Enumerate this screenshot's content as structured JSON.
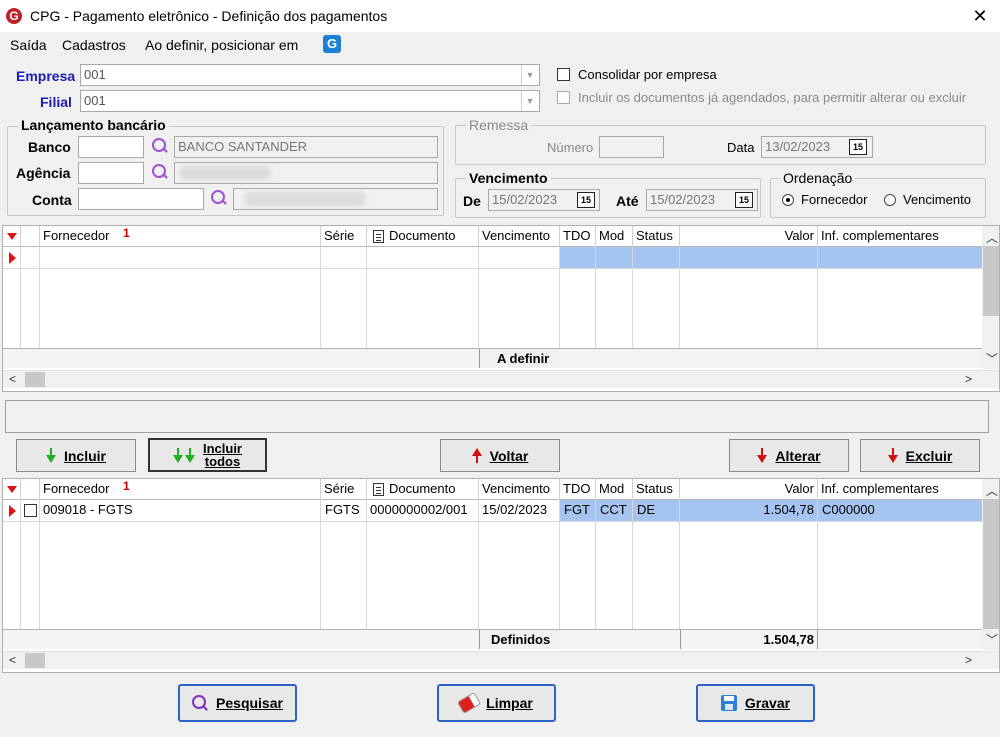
{
  "window": {
    "title": "CPG - Pagamento eletrônico - Definição dos pagamentos",
    "logo_letter": "G"
  },
  "menu": {
    "items": [
      "Saída",
      "Cadastros",
      "Ao definir, posicionar em"
    ],
    "g_icon": "G"
  },
  "filters": {
    "empresa_label": "Empresa",
    "empresa_value": "001",
    "filial_label": "Filial",
    "filial_value": "001",
    "consolidar_label": "Consolidar por empresa",
    "incluir_agendados_label": "Incluir os documentos já agendados, para permitir alterar ou excluir"
  },
  "lancamento": {
    "title": "Lançamento bancário",
    "banco_label": "Banco",
    "banco_name": "BANCO SANTANDER",
    "agencia_label": "Agência",
    "conta_label": "Conta"
  },
  "remessa": {
    "title": "Remessa",
    "numero_label": "Número",
    "data_label": "Data",
    "data_value": "13/02/2023",
    "cal_icon": "15"
  },
  "vencimento": {
    "title": "Vencimento",
    "de_label": "De",
    "de_value": "15/02/2023",
    "ate_label": "Até",
    "ate_value": "15/02/2023",
    "cal_icon": "15"
  },
  "ordenacao": {
    "title": "Ordenação",
    "options": [
      "Fornecedor",
      "Vencimento"
    ],
    "selected": "Fornecedor"
  },
  "grid_columns": {
    "fornecedor": "Fornecedor",
    "sort_indicator": "1",
    "serie": "Série",
    "documento": "Documento",
    "vencimento": "Vencimento",
    "tdo": "TDO",
    "mod": "Mod",
    "status": "Status",
    "valor": "Valor",
    "inf": "Inf. complementares"
  },
  "grid_top": {
    "footer_label": "A definir",
    "rows": []
  },
  "actions": {
    "incluir": "Incluir",
    "incluir_todos": "Incluir todos",
    "voltar": "Voltar",
    "alterar": "Alterar",
    "excluir": "Excluir"
  },
  "grid_bottom": {
    "rows": [
      {
        "fornecedor": "009018 - FGTS",
        "serie": "FGTS",
        "documento": "0000000002/001",
        "vencimento": "15/02/2023",
        "tdo": "FGT",
        "mod": "CCT",
        "status": "DE",
        "valor": "1.504,78",
        "inf": "C000000"
      }
    ],
    "footer_label": "Definidos",
    "footer_total": "1.504,78"
  },
  "bottom_buttons": {
    "pesquisar": "Pesquisar",
    "limpar": "Limpar",
    "gravar": "Gravar"
  },
  "scroll": {
    "left": "<",
    "right": ">",
    "up": "^",
    "down": "v"
  }
}
